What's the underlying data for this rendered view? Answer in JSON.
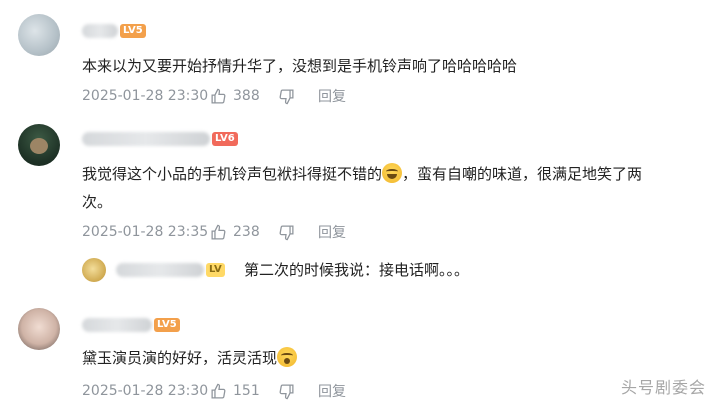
{
  "comments": [
    {
      "level": "LV5",
      "text": "本来以为又要开始抒情升华了，没想到是手机铃声响了哈哈哈哈哈",
      "timestamp": "2025-01-28 23:30",
      "likes": "388",
      "reply_label": "回复"
    },
    {
      "level": "LV6",
      "text_part1": "我觉得这个小品的手机铃声包袱抖得挺不错的",
      "text_part2": "，蛮有自嘲的味道，很满足地笑了两",
      "text_line2": "次。",
      "timestamp": "2025-01-28 23:35",
      "likes": "238",
      "reply_label": "回复",
      "sub_reply": {
        "badge": "LV",
        "text": "第二次的时候我说：接电话啊。。。"
      }
    },
    {
      "level": "LV5",
      "text": "黛玉演员演的好好，活灵活现",
      "timestamp": "2025-01-28 23:30",
      "likes": "151",
      "reply_label": "回复"
    }
  ],
  "watermark": "头号剧委会",
  "icons": {
    "like": "thumbs-up-icon",
    "dislike": "thumbs-down-icon",
    "emoji_laugh": "laughing-emoji-icon",
    "emoji_shock": "shocked-emoji-icon"
  }
}
